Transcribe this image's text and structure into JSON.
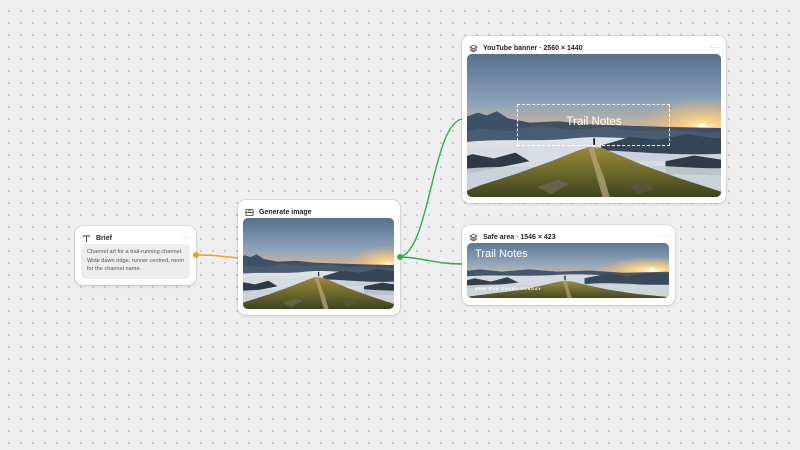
{
  "colors": {
    "edge_brief": "#f4a01c",
    "edge_generate": "#2ab24a",
    "canvas_bg": "#efefef"
  },
  "nodes": {
    "brief": {
      "icon": "text-icon",
      "title": "Brief",
      "menu": "···",
      "text": "Channel art for a trail-running channel. Wide dawn ridge, runner centred, room for the channel name."
    },
    "generate": {
      "icon": "image-generate-icon",
      "title": "Generate image",
      "menu": "···"
    },
    "banner": {
      "icon": "layers-icon",
      "title": "YouTube banner · 2560 × 1440",
      "menu": "···",
      "overlay_title": "Trail Notes"
    },
    "safe": {
      "icon": "layers-icon",
      "title": "Safe area · 1546 × 423",
      "menu": "···",
      "overlay_title": "Trail Notes",
      "overlay_tagline": "NEW RUN EVERY SUNDAY"
    }
  }
}
